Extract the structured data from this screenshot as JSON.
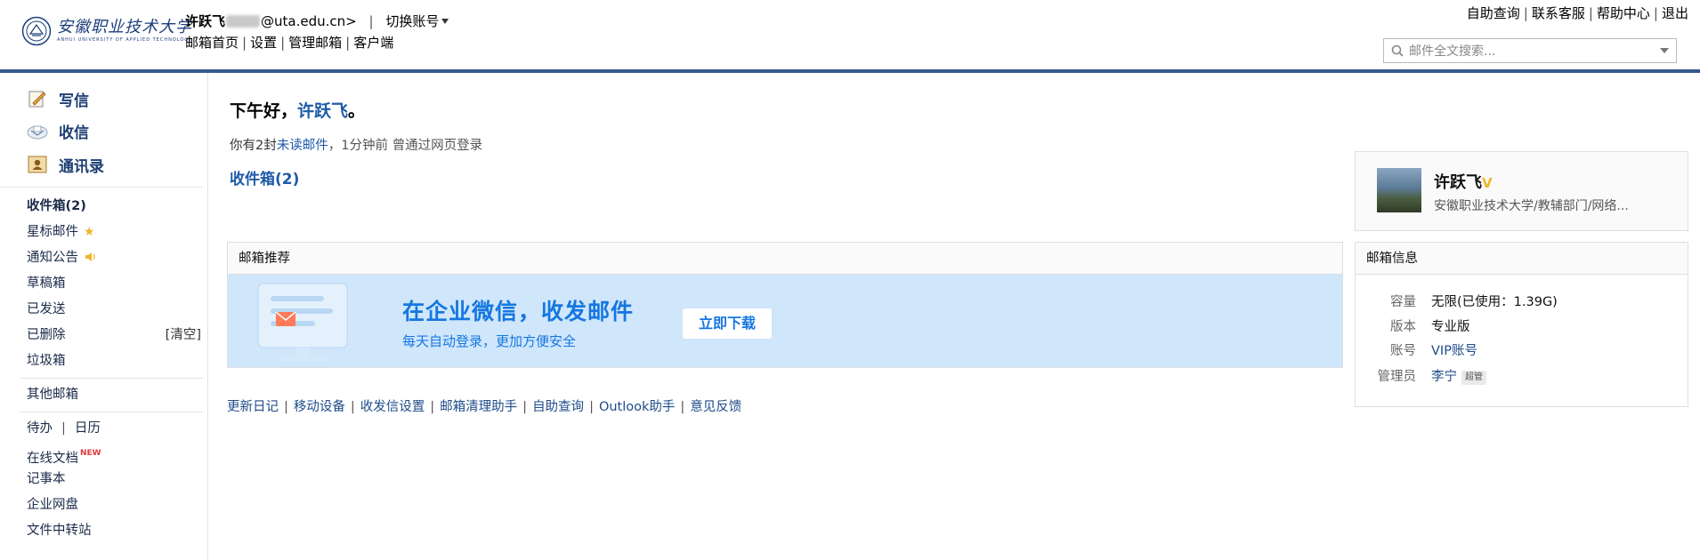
{
  "header": {
    "logo": {
      "cn": "安徽职业技术大学",
      "en": "ANHUI UNIVERSITY OF APPLIED TECHNOLOGY"
    },
    "account": {
      "name": "许跃飞",
      "email_suffix": "@uta.edu.cn>",
      "separator": "|",
      "switch_label": "切换账号"
    },
    "links": [
      "邮箱首页",
      "设置",
      "管理邮箱",
      "客户端"
    ],
    "top_right": [
      "自助查询",
      "联系客服",
      "帮助中心",
      "退出"
    ],
    "search": {
      "placeholder": "邮件全文搜索..."
    }
  },
  "sidebar": {
    "primary": [
      {
        "label": "写信",
        "icon": "compose-icon"
      },
      {
        "label": "收信",
        "icon": "receive-icon"
      },
      {
        "label": "通讯录",
        "icon": "contacts-icon"
      }
    ],
    "folders": {
      "inbox": "收件箱(2)",
      "starred": "星标邮件",
      "notices": "通知公告",
      "drafts": "草稿箱",
      "sent": "已发送",
      "deleted": "已删除",
      "deleted_action": "[清空]",
      "spam": "垃圾箱"
    },
    "other": "其他邮箱",
    "tools": {
      "todo": "待办",
      "calendar": "日历",
      "docs": "在线文档",
      "docs_badge": "NEW",
      "notes": "记事本",
      "disk": "企业网盘",
      "transfer": "文件中转站"
    }
  },
  "main": {
    "greeting_prefix": "下午好，",
    "greeting_name": "许跃飞",
    "greeting_suffix": "。",
    "notice_prefix": "你有2封",
    "notice_link": "未读邮件",
    "notice_rest": "，1分钟前 曾通过网页登录",
    "inbox_link": "收件箱(2)",
    "recommend": {
      "title": "邮箱推荐",
      "headline": "在企业微信，收发邮件",
      "subline": "每天自动登录，更加方便安全",
      "button": "立即下载"
    },
    "footer_links": [
      "更新日记",
      "移动设备",
      "收发信设置",
      "邮箱清理助手",
      "自助查询",
      "Outlook助手",
      "意见反馈"
    ]
  },
  "profile": {
    "name": "许跃飞",
    "badge": "V",
    "org": "安徽职业技术大学/教辅部门/网络..."
  },
  "mailbox_info": {
    "title": "邮箱信息",
    "rows": [
      {
        "key": "容量",
        "value": "无限(已使用：1.39G)"
      },
      {
        "key": "版本",
        "value": "专业版"
      },
      {
        "key": "账号",
        "value": "VIP账号"
      },
      {
        "key": "管理员",
        "value": "李宁",
        "tag": "超管"
      }
    ]
  },
  "colors": {
    "accent": "#1e5aa8",
    "header_bar": "#35588d",
    "banner_bg": "#cfe6fb",
    "banner_text": "#1677e0"
  }
}
